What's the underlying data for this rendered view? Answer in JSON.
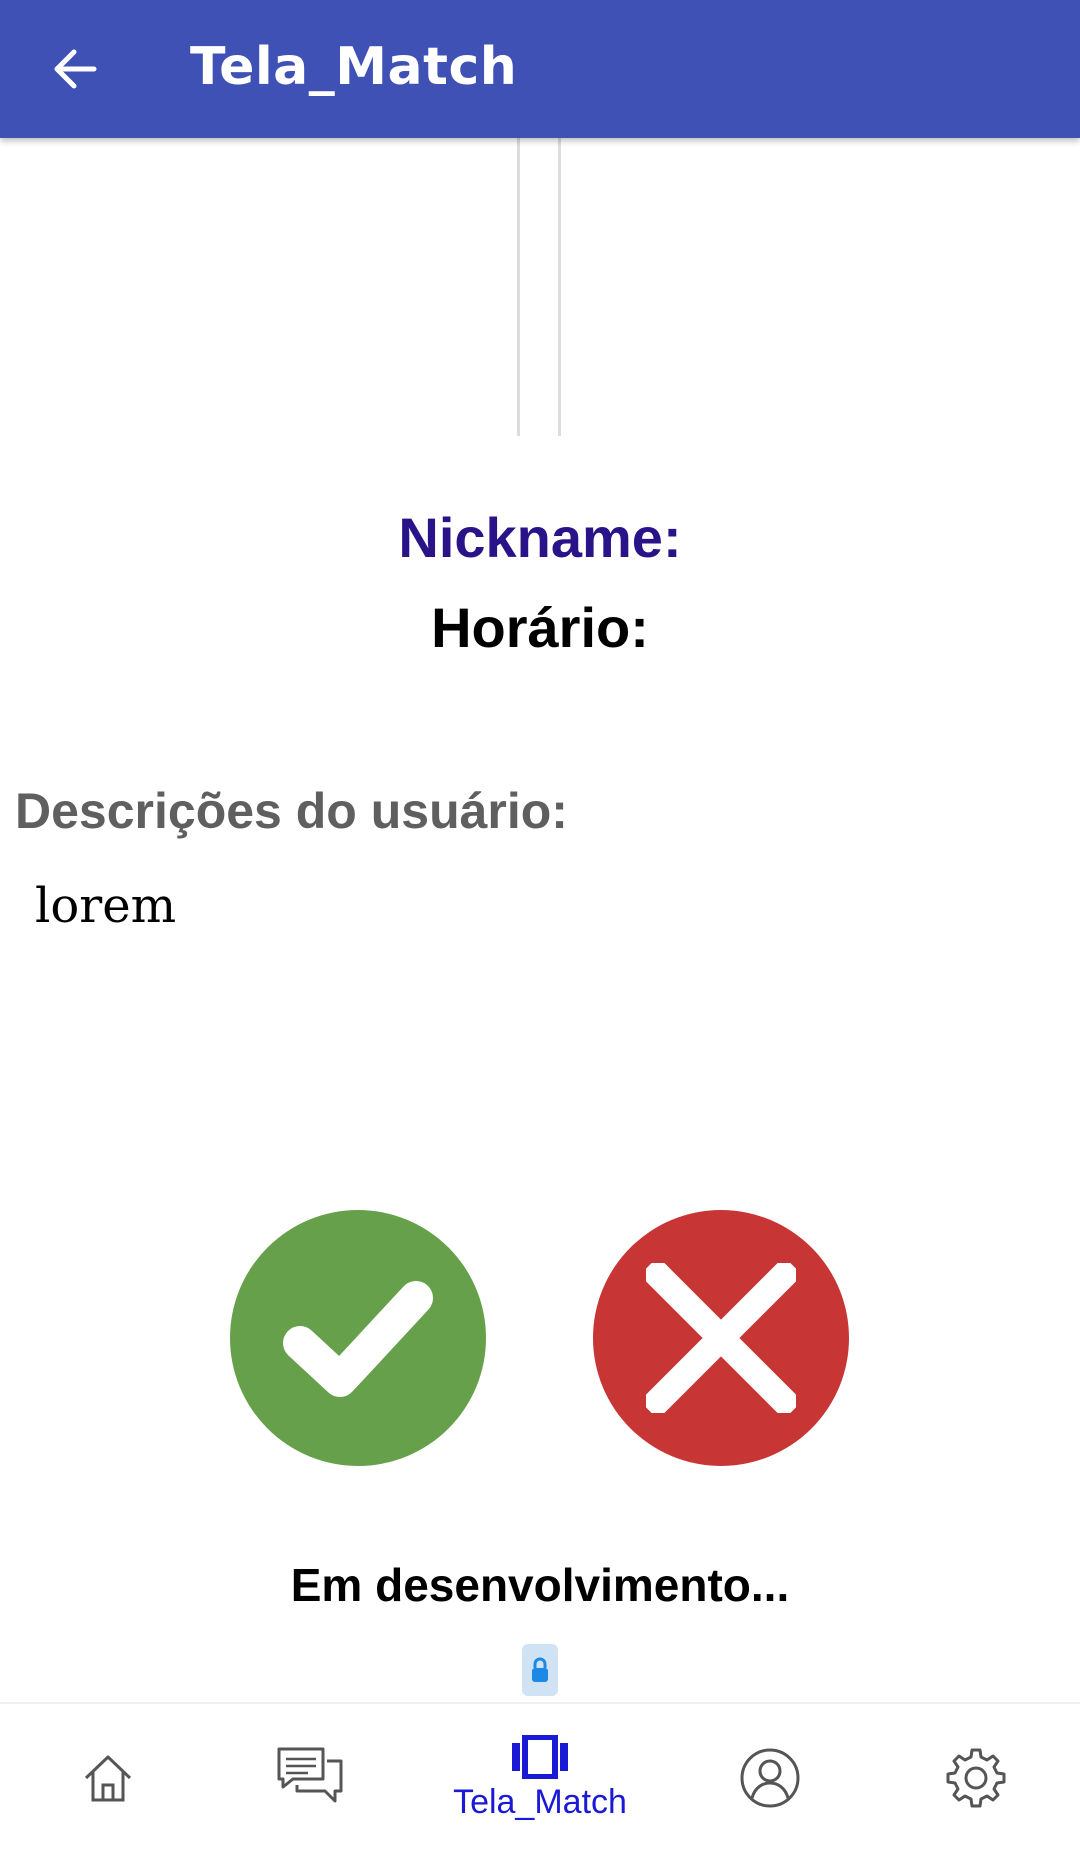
{
  "app_bar": {
    "title": "Tela_Match",
    "back_icon": "arrow-back-icon",
    "background": "#3F51B5"
  },
  "profile": {
    "nickname_label": "Nickname:",
    "schedule_label": "Horário:",
    "description_label": "Descrições do usuário:",
    "description_text": "lorem"
  },
  "actions": {
    "accept_icon": "check-icon",
    "accept_color": "#67A04B",
    "reject_icon": "close-icon",
    "reject_color": "#C73535"
  },
  "status": {
    "text": "Em desenvolvimento...",
    "badge_icon": "lock-icon"
  },
  "bottom_nav": {
    "active_color": "#1A1AD6",
    "items": [
      {
        "icon": "home-icon",
        "label": ""
      },
      {
        "icon": "chat-icon",
        "label": ""
      },
      {
        "icon": "cards-icon",
        "label": "Tela_Match"
      },
      {
        "icon": "profile-icon",
        "label": ""
      },
      {
        "icon": "gear-icon",
        "label": ""
      }
    ]
  }
}
